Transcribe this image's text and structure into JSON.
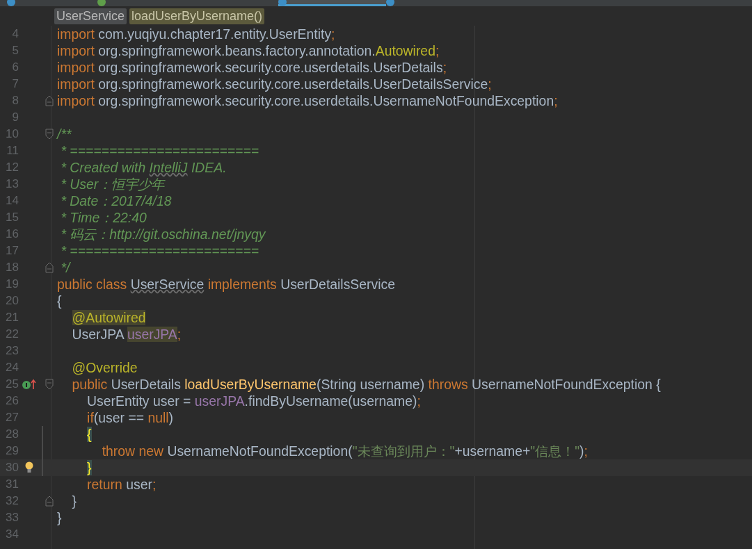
{
  "tabs": [
    {
      "kind": "class",
      "selected": false
    },
    {
      "kind": "interface",
      "selected": false
    },
    {
      "kind": "class",
      "selected": true
    },
    {
      "kind": "class",
      "selected": false
    }
  ],
  "breadcrumbs": [
    {
      "label": "UserService",
      "selected": false
    },
    {
      "label": "loadUserByUsername()",
      "selected": true
    }
  ],
  "lines": [
    {
      "number": "4",
      "tokens": [
        {
          "kind": "keyword",
          "text": "import "
        },
        {
          "kind": "plain",
          "text": "com.yuqiyu.chapter17.entity.UserEntity"
        },
        {
          "kind": "semicolon",
          "text": ";"
        }
      ]
    },
    {
      "number": "5",
      "tokens": [
        {
          "kind": "keyword",
          "text": "import "
        },
        {
          "kind": "plain",
          "text": "org.springframework.beans.factory.annotation."
        },
        {
          "kind": "annotation",
          "text": "Autowired"
        },
        {
          "kind": "semicolon",
          "text": ";"
        }
      ]
    },
    {
      "number": "6",
      "tokens": [
        {
          "kind": "keyword",
          "text": "import "
        },
        {
          "kind": "plain",
          "text": "org.springframework.security.core.userdetails.UserDetails"
        },
        {
          "kind": "semicolon",
          "text": ";"
        }
      ]
    },
    {
      "number": "7",
      "tokens": [
        {
          "kind": "keyword",
          "text": "import "
        },
        {
          "kind": "plain",
          "text": "org.springframework.security.core.userdetails.UserDetailsService"
        },
        {
          "kind": "semicolon",
          "text": ";"
        }
      ]
    },
    {
      "number": "8",
      "fold_end": true,
      "tokens": [
        {
          "kind": "keyword",
          "text": "import "
        },
        {
          "kind": "plain",
          "text": "org.springframework.security.core.userdetails.UsernameNotFoundException"
        },
        {
          "kind": "semicolon",
          "text": ";"
        }
      ]
    },
    {
      "number": "9"
    },
    {
      "number": "10",
      "fold_start": true,
      "tokens": [
        {
          "kind": "comment",
          "text": "/**"
        }
      ]
    },
    {
      "number": "11",
      "tokens": [
        {
          "kind": "comment",
          "text": " * ========================"
        }
      ]
    },
    {
      "number": "12",
      "tokens": [
        {
          "kind": "comment",
          "text": " * Created with "
        },
        {
          "kind": "comment",
          "text": "IntelliJ",
          "underlined": true
        },
        {
          "kind": "comment",
          "text": " IDEA."
        }
      ]
    },
    {
      "number": "13",
      "tokens": [
        {
          "kind": "comment",
          "text": " * User：恒宇少年"
        }
      ]
    },
    {
      "number": "14",
      "tokens": [
        {
          "kind": "comment",
          "text": " * Date：2017/4/18"
        }
      ]
    },
    {
      "number": "15",
      "tokens": [
        {
          "kind": "comment",
          "text": " * Time：22:40"
        }
      ]
    },
    {
      "number": "16",
      "tokens": [
        {
          "kind": "comment",
          "text": " * 码云：http://git.oschina.net/jnyqy"
        }
      ]
    },
    {
      "number": "17",
      "tokens": [
        {
          "kind": "comment",
          "text": " * ========================"
        }
      ]
    },
    {
      "number": "18",
      "fold_end": true,
      "tokens": [
        {
          "kind": "comment",
          "text": " */"
        }
      ]
    },
    {
      "number": "19",
      "tokens": [
        {
          "kind": "keyword",
          "text": "public class "
        },
        {
          "kind": "plain",
          "text": "UserService",
          "underlined": true
        },
        {
          "kind": "keyword",
          "text": " implements "
        },
        {
          "kind": "plain",
          "text": "UserDetailsService"
        }
      ]
    },
    {
      "number": "20",
      "tokens": [
        {
          "kind": "plain",
          "text": "{"
        }
      ]
    },
    {
      "number": "21",
      "tokens": [
        {
          "kind": "annotation",
          "text": "    @Autowired",
          "usage_highlight": true
        }
      ]
    },
    {
      "number": "22",
      "tokens": [
        {
          "kind": "plain",
          "text": "    UserJPA "
        },
        {
          "kind": "field",
          "text": "userJPA",
          "usage_highlight": true
        },
        {
          "kind": "semicolon",
          "text": ";"
        }
      ]
    },
    {
      "number": "23"
    },
    {
      "number": "24",
      "tokens": [
        {
          "kind": "annotation",
          "text": "    @Override"
        }
      ]
    },
    {
      "number": "25",
      "fold_start": true,
      "implements_marker": true,
      "tokens": [
        {
          "kind": "keyword",
          "text": "    public "
        },
        {
          "kind": "plain",
          "text": "UserDetails "
        },
        {
          "kind": "method",
          "text": "loadUserByUsername"
        },
        {
          "kind": "plain",
          "text": "(String username) "
        },
        {
          "kind": "keyword",
          "text": "throws "
        },
        {
          "kind": "plain",
          "text": "UsernameNotFoundException {"
        }
      ]
    },
    {
      "number": "26",
      "tokens": [
        {
          "kind": "plain",
          "text": "        UserEntity user = "
        },
        {
          "kind": "field",
          "text": "userJPA"
        },
        {
          "kind": "plain",
          "text": ".findByUsername(username)"
        },
        {
          "kind": "semicolon",
          "text": ";"
        }
      ]
    },
    {
      "number": "27",
      "tokens": [
        {
          "kind": "keyword",
          "text": "        if"
        },
        {
          "kind": "plain",
          "text": "(user == "
        },
        {
          "kind": "keyword",
          "text": "null"
        },
        {
          "kind": "plain",
          "text": ")"
        }
      ]
    },
    {
      "number": "28",
      "changed": true,
      "tokens": [
        {
          "kind": "plain",
          "text": "        {",
          "brace_match": true
        }
      ]
    },
    {
      "number": "29",
      "changed": true,
      "tokens": [
        {
          "kind": "keyword",
          "text": "            throw new "
        },
        {
          "kind": "plain",
          "text": "UsernameNotFoundException("
        },
        {
          "kind": "string",
          "text": "\"未查询到用户：\""
        },
        {
          "kind": "plain",
          "text": "+username+"
        },
        {
          "kind": "string",
          "text": "\"信息！\""
        },
        {
          "kind": "plain",
          "text": ")"
        },
        {
          "kind": "semicolon",
          "text": ";"
        }
      ]
    },
    {
      "number": "30",
      "changed": true,
      "current": true,
      "intention_bulb": true,
      "tokens": [
        {
          "kind": "plain",
          "text": "        }",
          "brace_match": true
        }
      ]
    },
    {
      "number": "31",
      "tokens": [
        {
          "kind": "keyword",
          "text": "        return "
        },
        {
          "kind": "plain",
          "text": "user"
        },
        {
          "kind": "semicolon",
          "text": ";"
        }
      ]
    },
    {
      "number": "32",
      "fold_end": true,
      "tokens": [
        {
          "kind": "plain",
          "text": "    }"
        }
      ]
    },
    {
      "number": "33",
      "tokens": [
        {
          "kind": "plain",
          "text": "}"
        }
      ]
    },
    {
      "number": "34"
    }
  ]
}
